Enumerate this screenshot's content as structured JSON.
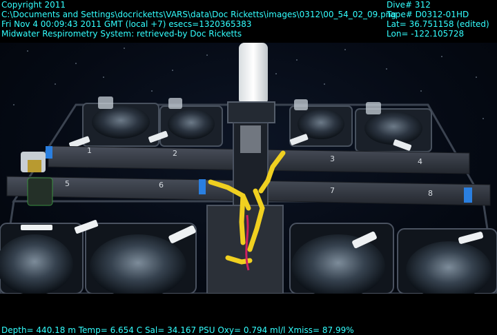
{
  "header": {
    "left_lines": [
      "Copyright 2011",
      "C:\\Documents and Settings\\docricketts\\VARS\\data\\Doc Ricketts\\images\\0312\\00_54_02_09.png",
      "Fri Nov  4 00:09:43 2011 GMT (local +7)  esecs=1320365383",
      "Midwater Respirometry System: retrieved-by Doc Ricketts"
    ],
    "right_lines": [
      "Dive# 312",
      "Tape# D0312-01HD",
      "Lat= 36.751158 (edited)",
      "Lon= -122.105728"
    ]
  },
  "footer": {
    "telemetry": "Depth= 440.18 m  Temp= 6.654 C  Sal= 34.167 PSU  Oxy= 0.794 ml/l  Xmiss= 87.99%"
  },
  "scene": {
    "chamber_numbers": [
      "1",
      "2",
      "3",
      "4",
      "5",
      "6",
      "7",
      "8"
    ],
    "colors": {
      "overlay_text": "#33ffff",
      "water": "#050a14",
      "frame": "#2a2f38",
      "bar": "#3a3f4a",
      "accent_blue": "#2a7fe0",
      "arm_yellow": "#f0d020"
    }
  }
}
